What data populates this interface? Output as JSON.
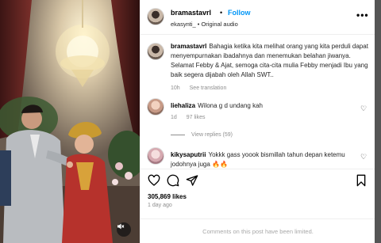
{
  "post": {
    "username": "bramastavrl",
    "follow_label": "Follow",
    "separator": "•",
    "subline": "ekasynti_ • Original audio",
    "more_label": "•••"
  },
  "caption": {
    "username": "bramastavrl",
    "text": "Bahagia ketika kita melihat orang yang kita perduli dapat menyempurnakan ibadahnya dan menemukan belahan jiwanya. Selamat Febby & Ajat, semoga cita-cita mulia Febby menjadi Ibu yang baik segera dijabah oleh Allah SWT..",
    "time": "10h",
    "see_translation": "See translation"
  },
  "comments": [
    {
      "username": "liehaliza",
      "text": "Wilona g d undang kah",
      "time": "1d",
      "likes": "97 likes",
      "view_replies": "View replies (59)"
    },
    {
      "username": "kikysaputrii",
      "text": "Yokkk gass yoook bismillah tahun depan ketemu jodohnya juga 🔥🔥",
      "time": "",
      "likes": ""
    }
  ],
  "stats": {
    "likes": "305,869 likes",
    "age": "1 day ago"
  },
  "footer": {
    "comments_limited": "Comments on this post have been limited."
  },
  "icons": {
    "heart": "heart-icon",
    "comment": "comment-icon",
    "share": "share-icon",
    "save": "bookmark-icon",
    "mute": "mute-icon"
  },
  "colors": {
    "accent": "#0095f6",
    "muted": "#8e8e8e"
  }
}
